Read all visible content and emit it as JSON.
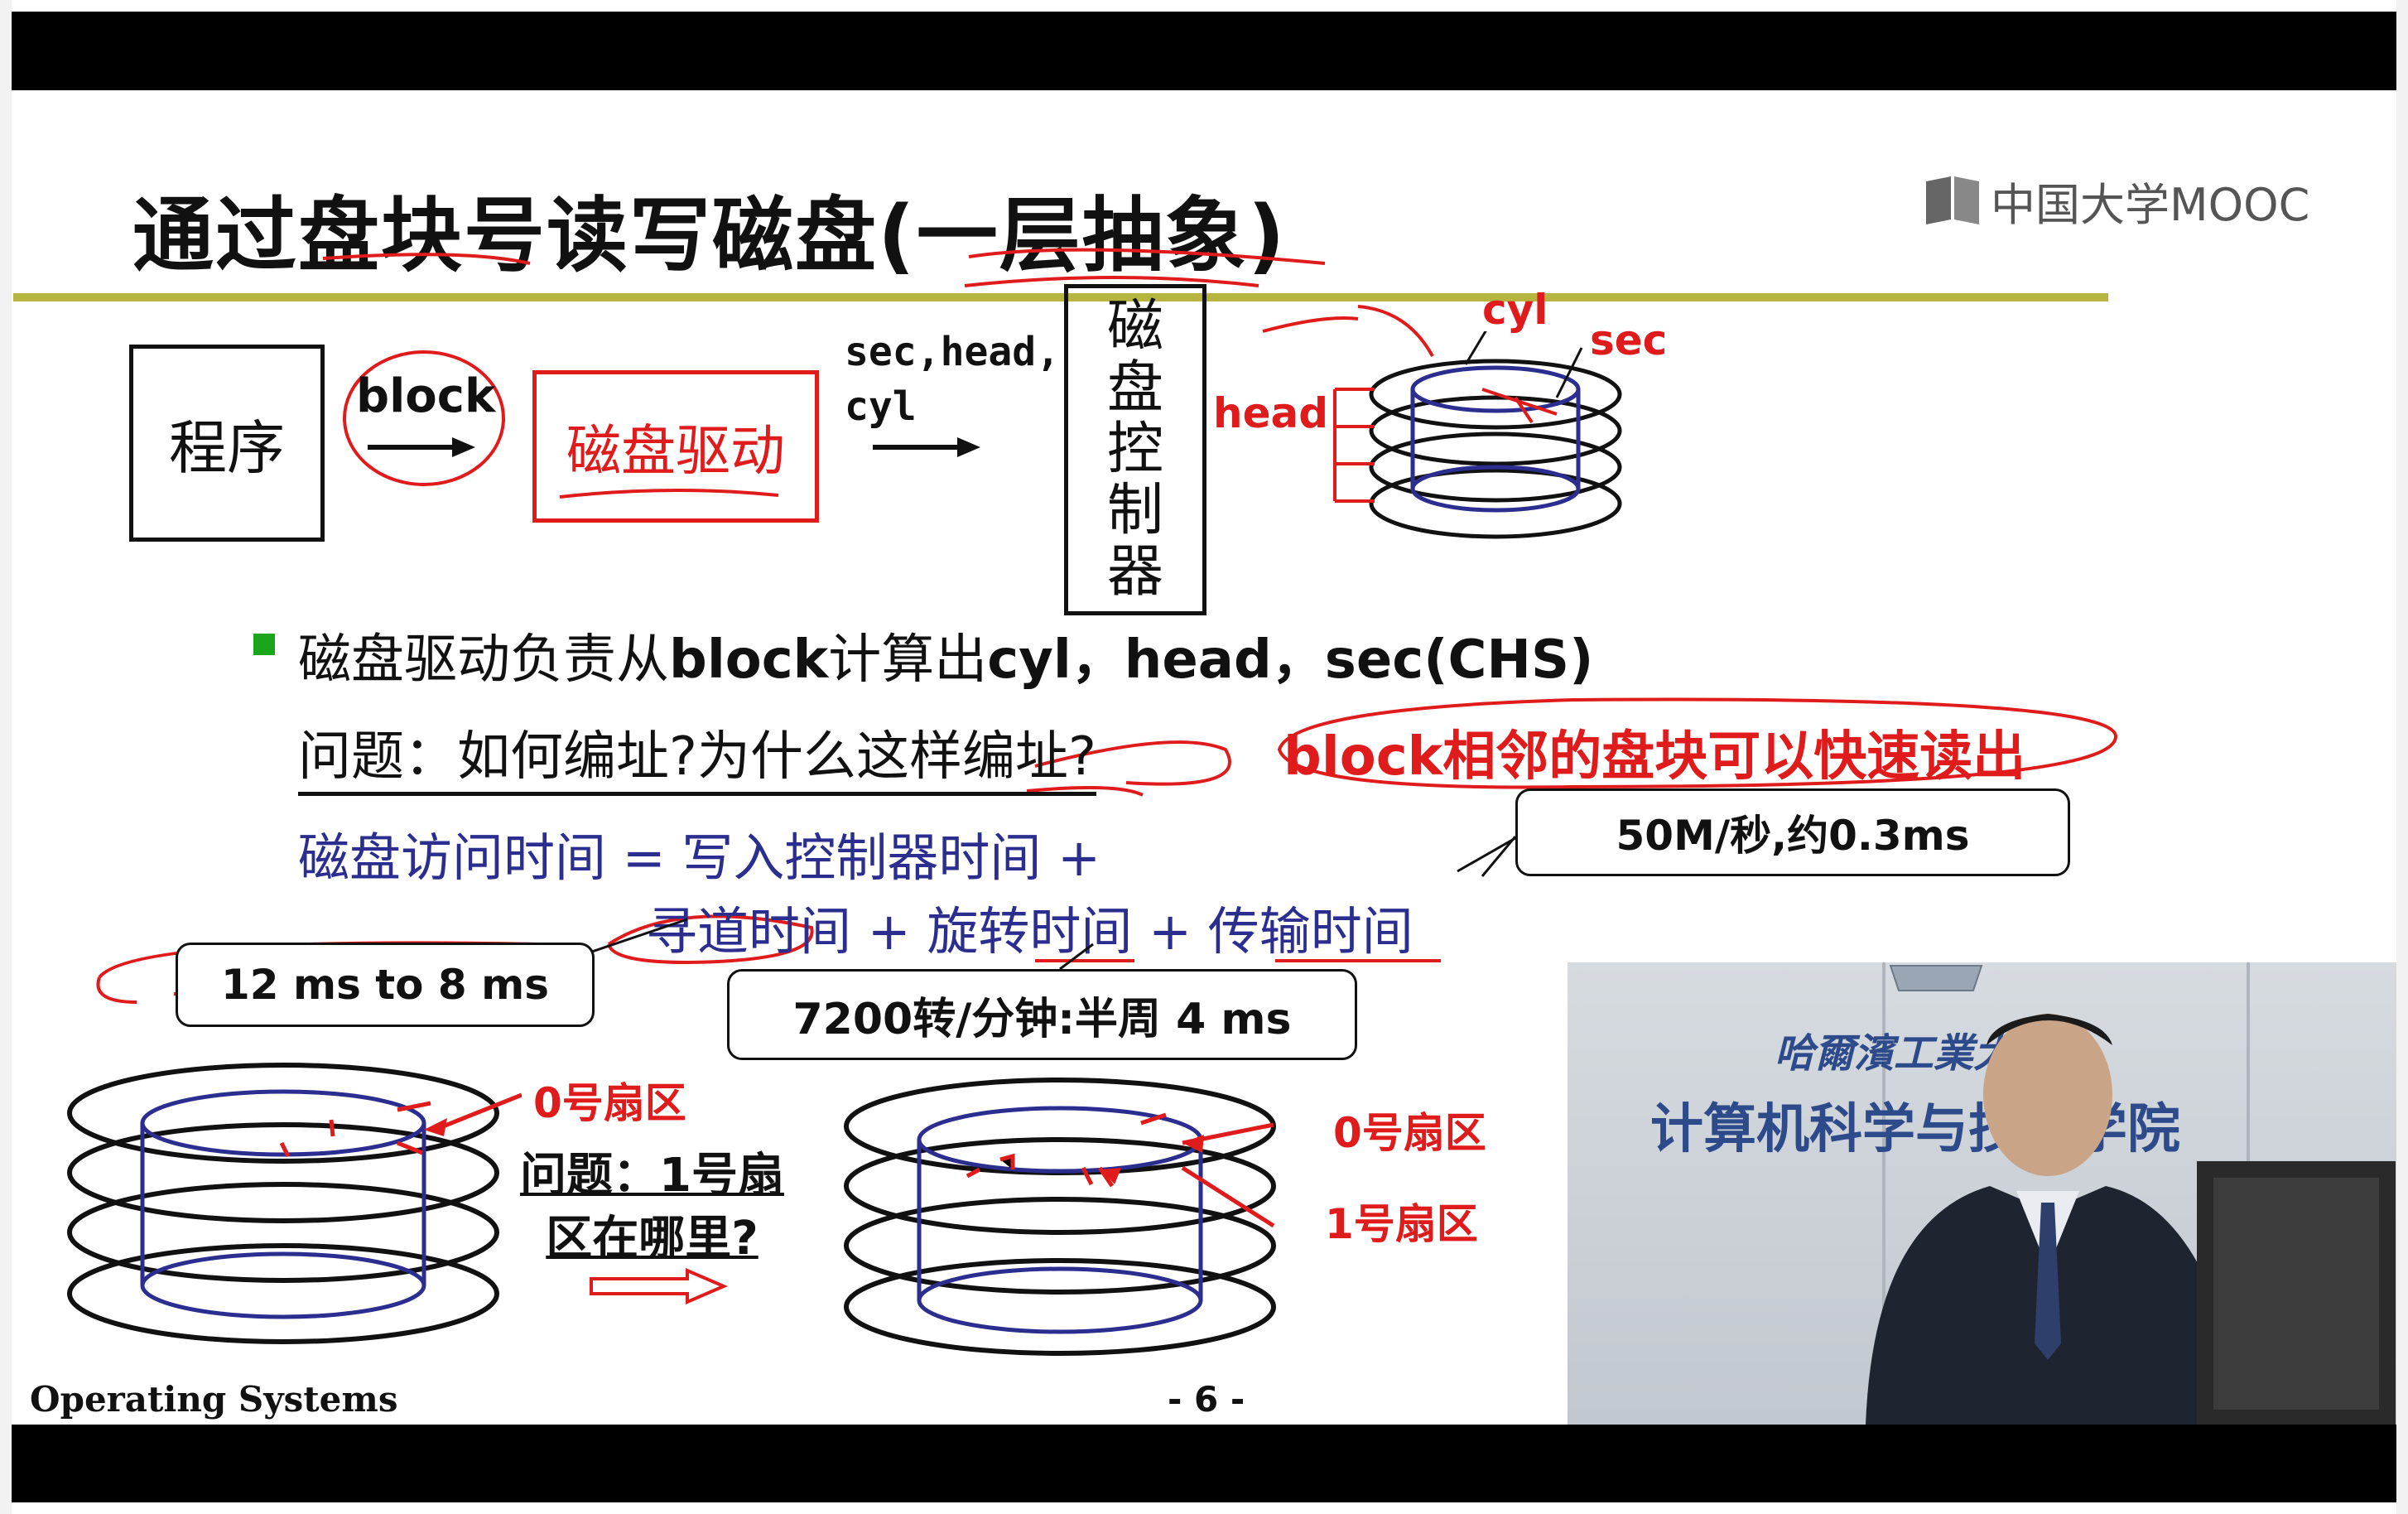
{
  "slide": {
    "title": "通过盘块号读写磁盘(一层抽象)",
    "logo_text": "中国大学MOOC",
    "diagram": {
      "program_box": "程序",
      "block_label": "block",
      "driver_box": "磁盘驱动",
      "chs_label": "sec,head,\ncyl",
      "controller_chars": [
        "磁",
        "盘",
        "控",
        "制",
        "器"
      ],
      "disk_labels": {
        "cyl": "cyl",
        "sec": "sec",
        "head": "head"
      }
    },
    "bullet_prefix": "磁盘驱动负责从",
    "bullet_block": "block",
    "bullet_mid": "计算出",
    "bullet_chs": "cyl，head，sec(CHS)",
    "question": "问题：如何编址?为什么这样编址?",
    "answer_red": "block相邻的盘块可以快速读出",
    "access_time_line1": "磁盘访问时间 =  写入控制器时间 +",
    "access_time_line2": "寻道时间 + 旋转时间 + 传输时间",
    "callout_transfer": "50M/秒,约0.3ms",
    "callout_seek": "12 ms to 8 ms",
    "callout_rotate": "7200转/分钟:半周 4 ms",
    "sector0_label_left": "0号扇区",
    "question2_line1": "问题：1号扇",
    "question2_line2": "区在哪里?",
    "sector0_label_right": "0号扇区",
    "sector1_label_right": "1号扇区",
    "footer_course": "Operating Systems",
    "footer_page": "- 6 -"
  },
  "video": {
    "sign_line1": "哈爾濱工業大",
    "sign_line2": "计算机科学与技术学院"
  },
  "colors": {
    "accent_red": "#e01b1b",
    "formula_blue": "#2b2e8f",
    "rule_olive": "#b5b53f",
    "bullet_green": "#1aa51a"
  }
}
